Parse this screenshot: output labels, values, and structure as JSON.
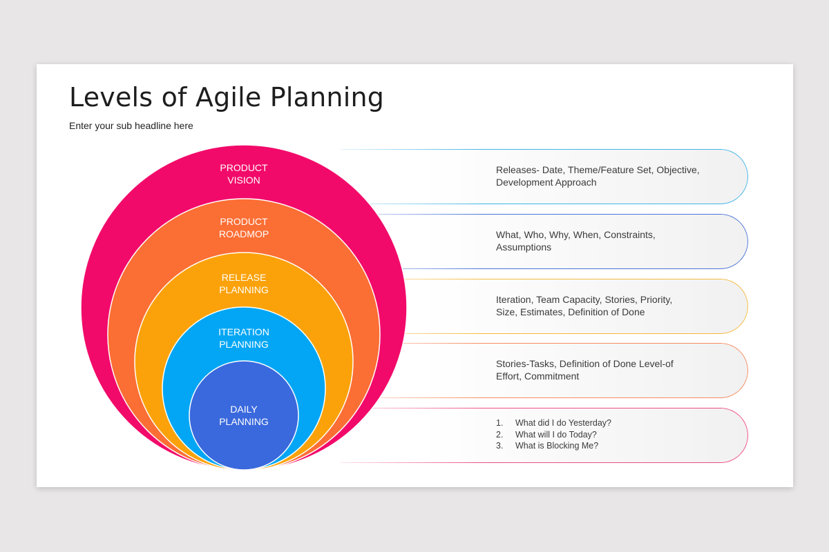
{
  "title": "Levels of Agile Planning",
  "subtitle": "Enter your sub headline here",
  "levels": [
    {
      "label_line1": "PRODUCT",
      "label_line2": "VISION",
      "color": "#f20a6a",
      "detail_line1": "Releases- Date, Theme/Feature Set, Objective,",
      "detail_line2": "Development Approach",
      "accent": "#3fb3e8"
    },
    {
      "label_line1": "PRODUCT",
      "label_line2": "ROADMOP",
      "color": "#fb6e34",
      "detail_line1": "What, Who, Why, When, Constraints,",
      "detail_line2": "Assumptions",
      "accent": "#4a72d6"
    },
    {
      "label_line1": "RELEASE",
      "label_line2": "PLANNING",
      "color": "#fba20a",
      "detail_line1": "Iteration, Team Capacity, Stories, Priority,",
      "detail_line2": "Size, Estimates, Definition of Done",
      "accent": "#f5b93c"
    },
    {
      "label_line1": "ITERATION",
      "label_line2": "PLANNING",
      "color": "#03a6f4",
      "detail_line1": "Stories-Tasks, Definition of Done Level-of",
      "detail_line2": "Effort, Commitment",
      "accent": "#f68a5f"
    },
    {
      "label_line1": "DAILY",
      "label_line2": "PLANNING",
      "color": "#3a69dd",
      "accent": "#ee4b86",
      "list": [
        {
          "num": "1.",
          "text": "What did I do Yesterday?"
        },
        {
          "num": "2.",
          "text": "What will I do Today?"
        },
        {
          "num": "3.",
          "text": "What is Blocking Me?"
        }
      ]
    }
  ]
}
